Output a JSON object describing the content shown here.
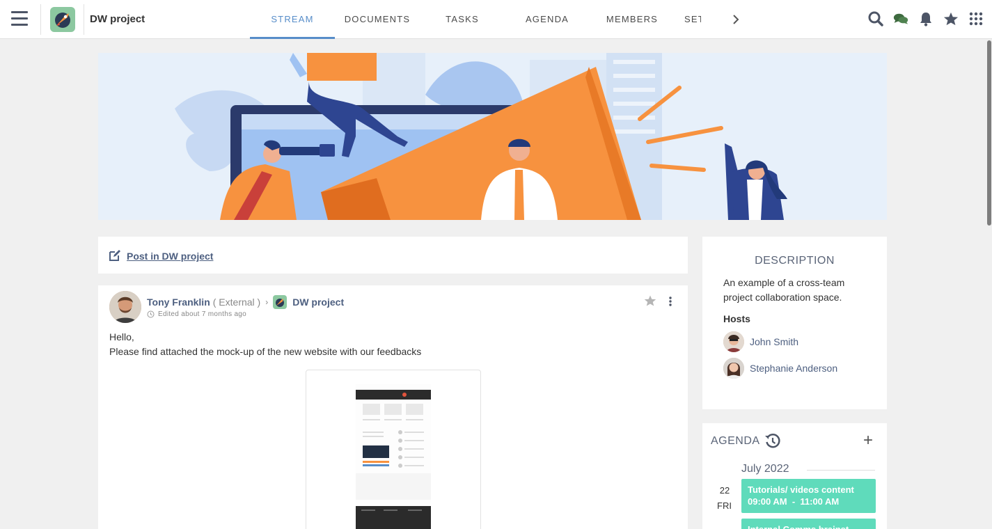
{
  "header": {
    "space_title": "DW project",
    "tabs": [
      {
        "label": "STREAM"
      },
      {
        "label": "DOCUMENTS"
      },
      {
        "label": "TASKS"
      },
      {
        "label": "AGENDA"
      },
      {
        "label": "MEMBERS"
      },
      {
        "label": "SETT"
      }
    ],
    "active_tab": "STREAM",
    "icons": [
      "search-icon",
      "chat-icon",
      "notifications-icon",
      "favorites-icon",
      "apps-icon"
    ]
  },
  "composer": {
    "label": "Post in DW project"
  },
  "activity": {
    "author": "Tony Franklin",
    "author_tag": "( External )",
    "space": "DW project",
    "edited": "Edited about 7 months ago",
    "body_line1": "Hello,",
    "body_line2": "Please find attached the mock-up of the new website with our feedbacks"
  },
  "description": {
    "title": "DESCRIPTION",
    "text": "An example of a cross-team project collaboration space.",
    "hosts_label": "Hosts",
    "hosts": [
      {
        "name": "John Smith"
      },
      {
        "name": "Stephanie Anderson"
      }
    ]
  },
  "agenda": {
    "title": "AGENDA",
    "month": "July 2022",
    "day_number": "22",
    "day_name": "FRI",
    "events": [
      {
        "title": "Tutorials/ videos content",
        "time": "09:00 AM  -  11:00 AM"
      },
      {
        "title": "Internal Comms brainst",
        "time": ""
      }
    ]
  },
  "colors": {
    "accent": "#578dc9",
    "link": "#4d5f80",
    "event": "#5fdbbb",
    "banner_orange": "#f7923f",
    "banner_navy": "#223a7a"
  }
}
